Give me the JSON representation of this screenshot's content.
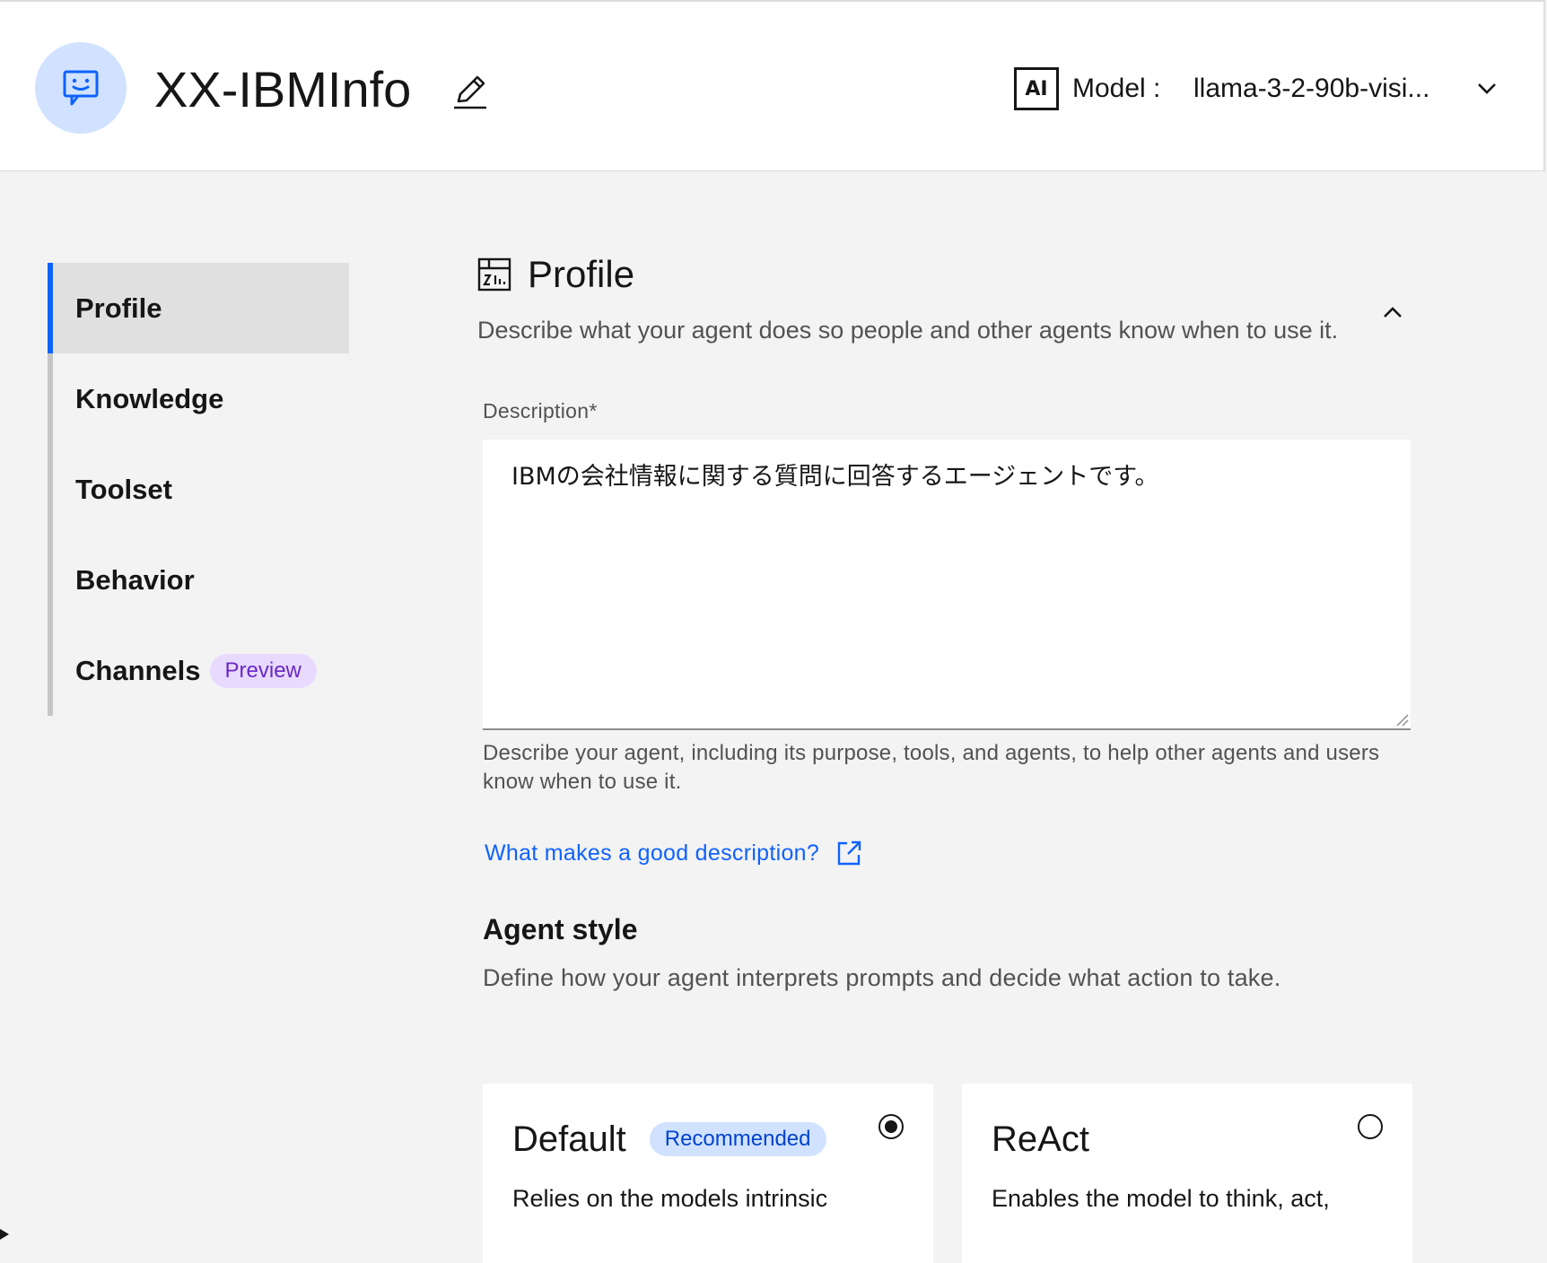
{
  "header": {
    "agent_name": "XX-IBMInfo",
    "ai_badge": "AI",
    "model_label": "Model :",
    "model_value": "llama-3-2-90b-visi..."
  },
  "sidebar": {
    "items": [
      {
        "label": "Profile",
        "active": true
      },
      {
        "label": "Knowledge"
      },
      {
        "label": "Toolset"
      },
      {
        "label": "Behavior"
      },
      {
        "label": "Channels",
        "tag": "Preview"
      }
    ]
  },
  "main": {
    "section_title": "Profile",
    "section_desc": "Describe what your agent does so people and other agents know when to use it.",
    "description_label": "Description*",
    "description_value": "IBMの会社情報に関する質問に回答するエージェントです。",
    "description_helper": "Describe your agent, including its purpose, tools, and agents, to help other agents and users know when to use it.",
    "help_link": "What makes a good description?",
    "agent_style_title": "Agent style",
    "agent_style_desc": "Define how your agent interprets prompts and decide what action to take.",
    "styles": [
      {
        "title": "Default",
        "tag": "Recommended",
        "desc": "Relies on the models intrinsic",
        "selected": true
      },
      {
        "title": "ReAct",
        "desc": "Enables the model to think, act,",
        "selected": false
      }
    ]
  },
  "colors": {
    "accent": "#0f62fe",
    "avatar_bg": "#d0e2ff",
    "preview_tag_bg": "#e8daff",
    "preview_tag_text": "#6929c4",
    "recommended_tag_bg": "#d0e2ff",
    "recommended_tag_text": "#0043ce"
  },
  "icons": [
    "chat-bot-icon",
    "edit-icon",
    "chevron-down-icon",
    "profile-icon",
    "chevron-up-icon",
    "launch-icon"
  ]
}
